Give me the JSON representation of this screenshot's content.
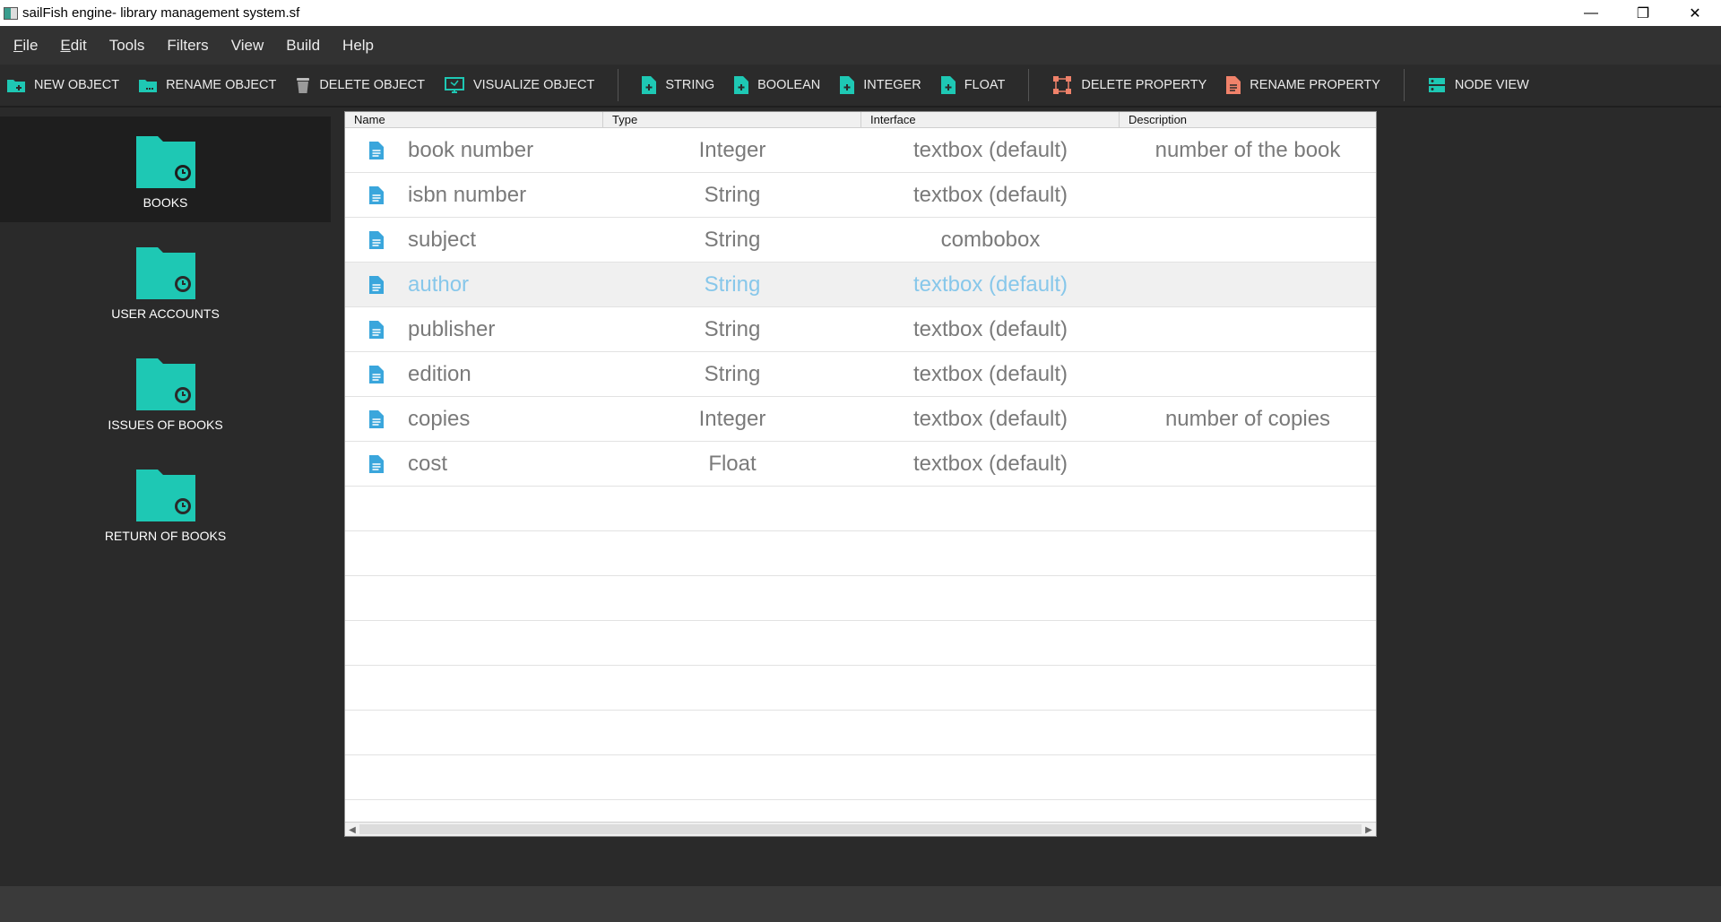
{
  "window": {
    "title": "sailFish engine- library management system.sf",
    "minimize": "—",
    "maximize": "❐",
    "close": "✕"
  },
  "menu": [
    {
      "label": "File",
      "accel": "F",
      "rest": "ile"
    },
    {
      "label": "Edit",
      "accel": "E",
      "rest": "dit"
    },
    {
      "label": "Tools",
      "accel": "",
      "rest": "Tools"
    },
    {
      "label": "Filters",
      "accel": "",
      "rest": "Filters"
    },
    {
      "label": "View",
      "accel": "",
      "rest": "View"
    },
    {
      "label": "Build",
      "accel": "",
      "rest": "Build"
    },
    {
      "label": "Help",
      "accel": "",
      "rest": "Help"
    }
  ],
  "toolbar": {
    "new_object": "NEW OBJECT",
    "rename_object": "RENAME OBJECT",
    "delete_object": "DELETE OBJECT",
    "visualize_object": "VISUALIZE OBJECT",
    "string": "STRING",
    "boolean": "BOOLEAN",
    "integer": "INTEGER",
    "float": "FLOAT",
    "delete_property": "DELETE PROPERTY",
    "rename_property": "RENAME PROPERTY",
    "node_view": "NODE VIEW"
  },
  "colors": {
    "accent": "#1ec8b4",
    "folder": "#1ec8b4",
    "doc_icon": "#3aa6dc",
    "highlight_text": "#87c7ea",
    "delete_accent": "#f0826a"
  },
  "objects": [
    {
      "label": "BOOKS",
      "selected": true
    },
    {
      "label": "USER ACCOUNTS",
      "selected": false
    },
    {
      "label": "ISSUES OF BOOKS",
      "selected": false
    },
    {
      "label": "RETURN OF BOOKS",
      "selected": false
    }
  ],
  "table": {
    "columns": [
      "Name",
      "Type",
      "Interface",
      "Description"
    ],
    "rows": [
      {
        "name": "book number",
        "type": "Integer",
        "interface": "textbox (default)",
        "description": "number of the book"
      },
      {
        "name": "isbn number",
        "type": "String",
        "interface": "textbox (default)",
        "description": ""
      },
      {
        "name": "subject",
        "type": "String",
        "interface": "combobox",
        "description": ""
      },
      {
        "name": "author",
        "type": "String",
        "interface": "textbox (default)",
        "description": "",
        "highlighted": true
      },
      {
        "name": "publisher",
        "type": "String",
        "interface": "textbox (default)",
        "description": ""
      },
      {
        "name": "edition",
        "type": "String",
        "interface": "textbox (default)",
        "description": ""
      },
      {
        "name": "copies",
        "type": "Integer",
        "interface": "textbox (default)",
        "description": "number of copies"
      },
      {
        "name": "cost",
        "type": "Float",
        "interface": "textbox (default)",
        "description": ""
      }
    ]
  }
}
